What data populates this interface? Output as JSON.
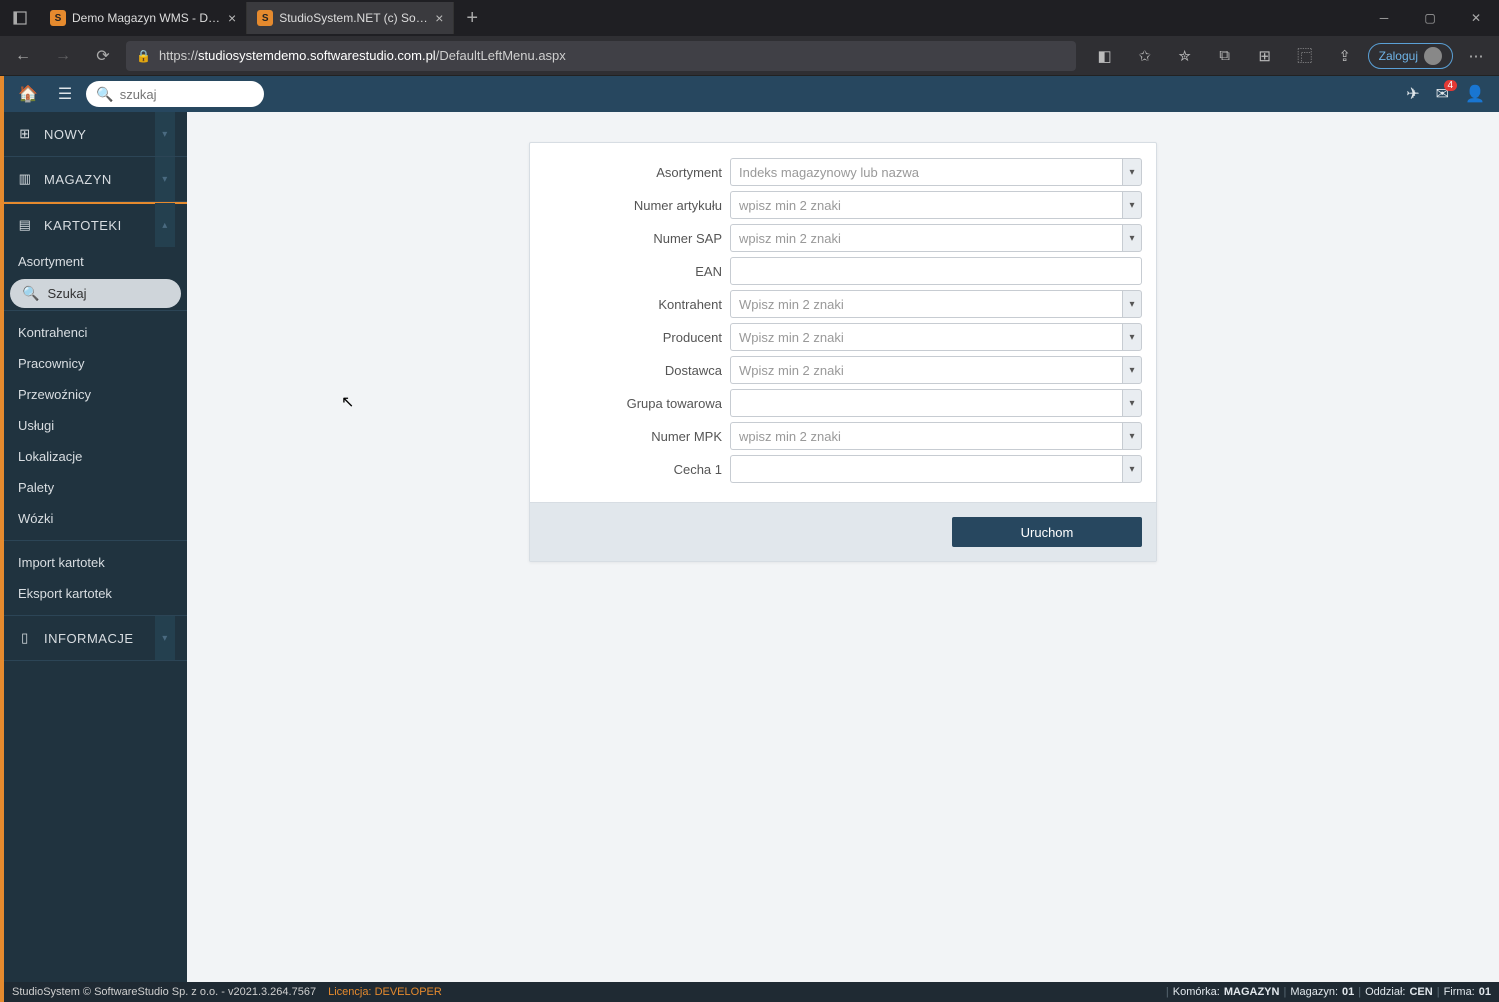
{
  "browser": {
    "tabs": [
      {
        "title": "Demo Magazyn WMS - Demo o"
      },
      {
        "title": "StudioSystem.NET (c) SoftwareSt"
      }
    ],
    "url_prefix": "https://",
    "url_host": "studiosystemdemo.softwarestudio.com.pl",
    "url_path": "/DefaultLeftMenu.aspx",
    "login_label": "Zaloguj"
  },
  "search_placeholder": "szukaj",
  "sidebar": {
    "sections": {
      "nowy": "NOWY",
      "magazyn": "MAGAZYN",
      "kartoteki": "KARTOTEKI",
      "informacje": "INFORMACJE"
    },
    "items": [
      "Asortyment",
      "Szukaj",
      "Kontrahenci",
      "Pracownicy",
      "Przewoźnicy",
      "Usługi",
      "Lokalizacje",
      "Palety",
      "Wózki",
      "Import kartotek",
      "Eksport kartotek"
    ]
  },
  "form": {
    "labels": {
      "asortyment": "Asortyment",
      "numer_artykulu": "Numer artykułu",
      "numer_sap": "Numer SAP",
      "ean": "EAN",
      "kontrahent": "Kontrahent",
      "producent": "Producent",
      "dostawca": "Dostawca",
      "grupa_towarowa": "Grupa towarowa",
      "numer_mpk": "Numer MPK",
      "cecha1": "Cecha 1"
    },
    "placeholders": {
      "asortyment": "Indeks magazynowy lub nazwa",
      "min2_lower": "wpisz min 2 znaki",
      "min2_cap": "Wpisz min 2 znaki"
    },
    "run": "Uruchom"
  },
  "mail_badge": "4",
  "status": {
    "left": "StudioSystem © SoftwareStudio Sp. z o.o. - v2021.3.264.7567",
    "lic_label": "Licencja: ",
    "lic_value": "DEVELOPER",
    "right": {
      "komorka_label": "Komórka:",
      "komorka_value": "MAGAZYN",
      "magazyn_label": "Magazyn:",
      "magazyn_value": "01",
      "oddzial_label": "Oddział:",
      "oddzial_value": "CEN",
      "firma_label": "Firma:",
      "firma_value": "01"
    }
  }
}
